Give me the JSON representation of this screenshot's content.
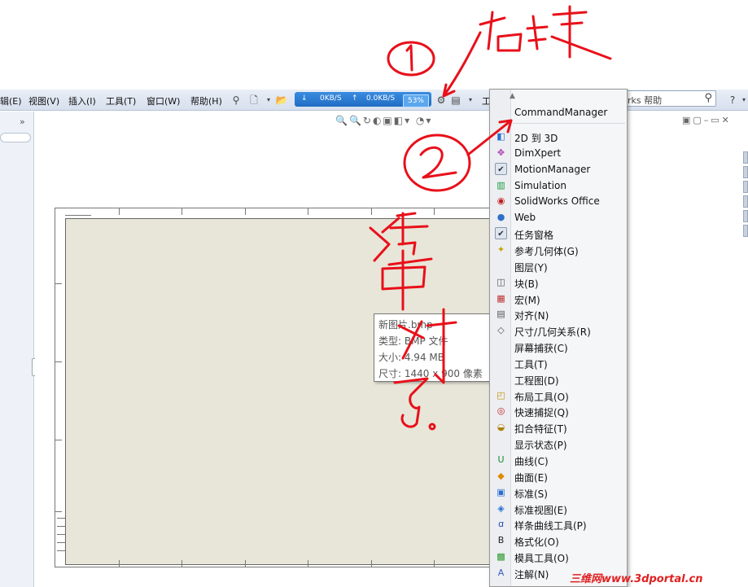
{
  "menubar": {
    "items": [
      "辑(E)",
      "视图(V)",
      "插入(I)",
      "工具(T)",
      "窗口(W)",
      "帮助(H)"
    ],
    "toolbar_glyph": "工"
  },
  "netbar": {
    "down": "0KB/S",
    "up": "0.0KB/S",
    "percent": "53%"
  },
  "help_search": {
    "placeholder": "rks 帮助",
    "help_label": "?"
  },
  "tooltip": {
    "line1": "新图片.bmp",
    "line2": "类型: BMP 文件",
    "line3": "大小: 4.94 MB",
    "line4": "尺寸: 1440 x 900 像素"
  },
  "context_menu": {
    "items": [
      {
        "label": "CommandManager",
        "icon": "none",
        "checked": false
      },
      {
        "label": "2D 到 3D",
        "icon": "2d-to-3d-icon",
        "checked": false
      },
      {
        "label": "DimXpert",
        "icon": "dimxpert-icon",
        "checked": false
      },
      {
        "label": "MotionManager",
        "icon": "check-icon",
        "checked": true
      },
      {
        "label": "Simulation",
        "icon": "simulation-icon",
        "checked": false
      },
      {
        "label": "SolidWorks Office",
        "icon": "office-icon",
        "checked": false
      },
      {
        "label": "Web",
        "icon": "globe-icon",
        "checked": false
      },
      {
        "label": "任务窗格",
        "icon": "check-icon",
        "checked": true
      },
      {
        "label": "参考几何体(G)",
        "icon": "ref-geometry-icon",
        "checked": false
      },
      {
        "label": "图层(Y)",
        "icon": "none",
        "checked": false
      },
      {
        "label": "块(B)",
        "icon": "block-icon",
        "checked": false
      },
      {
        "label": "宏(M)",
        "icon": "macro-icon",
        "checked": false
      },
      {
        "label": "对齐(N)",
        "icon": "align-icon",
        "checked": false
      },
      {
        "label": "尺寸/几何关系(R)",
        "icon": "dimension-icon",
        "checked": false
      },
      {
        "label": "屏幕捕获(C)",
        "icon": "none",
        "checked": false
      },
      {
        "label": "工具(T)",
        "icon": "none",
        "checked": false
      },
      {
        "label": "工程图(D)",
        "icon": "none",
        "checked": false
      },
      {
        "label": "布局工具(O)",
        "icon": "layout-icon",
        "checked": false
      },
      {
        "label": "快速捕捉(Q)",
        "icon": "snap-icon",
        "checked": false
      },
      {
        "label": "扣合特征(T)",
        "icon": "fastening-icon",
        "checked": false
      },
      {
        "label": "显示状态(P)",
        "icon": "none",
        "checked": false
      },
      {
        "label": "曲线(C)",
        "icon": "curve-icon",
        "checked": false
      },
      {
        "label": "曲面(E)",
        "icon": "surface-icon",
        "checked": false
      },
      {
        "label": "标准(S)",
        "icon": "standard-icon",
        "checked": false
      },
      {
        "label": "标准视图(E)",
        "icon": "std-view-icon",
        "checked": false
      },
      {
        "label": "样条曲线工具(P)",
        "icon": "spline-icon",
        "checked": false
      },
      {
        "label": "格式化(O)",
        "icon": "format-icon",
        "checked": false
      },
      {
        "label": "模具工具(O)",
        "icon": "mold-icon",
        "checked": false
      },
      {
        "label": "注解(N)",
        "icon": "annotation-icon",
        "checked": false
      }
    ]
  },
  "annotations": {
    "circle1": "1",
    "right_click": "右键",
    "circle2": "2",
    "select": "选中",
    "checkmark_text": "对了"
  },
  "watermark": "三维网www.3dportal.cn",
  "colors": {
    "annotation_red": "#e8101a",
    "netbar_blue": "#1f6cc4"
  }
}
